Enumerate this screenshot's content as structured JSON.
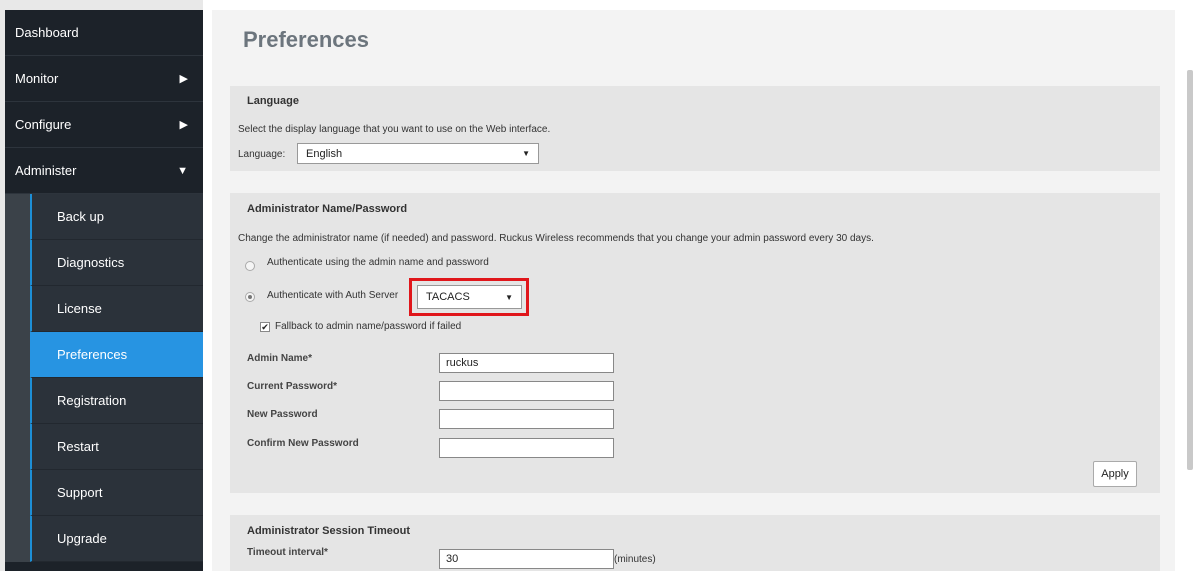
{
  "sidebar": {
    "top_items": [
      {
        "label": "Dashboard"
      },
      {
        "label": "Monitor"
      },
      {
        "label": "Configure"
      },
      {
        "label": "Administer"
      }
    ],
    "sub_items": [
      {
        "label": "Back up"
      },
      {
        "label": "Diagnostics"
      },
      {
        "label": "License"
      },
      {
        "label": "Preferences"
      },
      {
        "label": "Registration"
      },
      {
        "label": "Restart"
      },
      {
        "label": "Support"
      },
      {
        "label": "Upgrade"
      }
    ],
    "active_item": "Preferences"
  },
  "page": {
    "title": "Preferences"
  },
  "language": {
    "title": "Language",
    "description": "Select the display language that you want to use on the Web interface.",
    "label": "Language:",
    "value": "English"
  },
  "admin": {
    "title": "Administrator Name/Password",
    "description": "Change the administrator name (if needed) and password. Ruckus Wireless recommends that you change your admin password every 30 days.",
    "radio_local": "Authenticate using the admin name and password",
    "radio_server": "Authenticate with Auth Server",
    "auth_server_value": "TACACS",
    "fallback_label": "Fallback to admin name/password if failed",
    "fallback_checked": true,
    "admin_name_label": "Admin Name*",
    "admin_name_value": "ruckus",
    "current_password_label": "Current Password*",
    "new_password_label": "New Password",
    "confirm_password_label": "Confirm New Password",
    "apply_label": "Apply"
  },
  "session": {
    "title": "Administrator Session Timeout",
    "timeout_label": "Timeout interval*",
    "timeout_value": "30",
    "unit": "(minutes)"
  },
  "colors": {
    "sidebar_bg": "#1c2229",
    "active_item": "#2794e2",
    "highlight": "#e0161b"
  }
}
